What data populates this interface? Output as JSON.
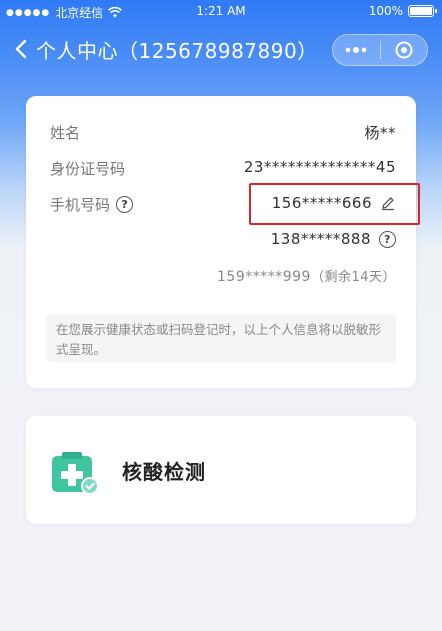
{
  "status_bar": {
    "signal_dots": "●●●●●",
    "carrier": "北京经信",
    "wifi_icon": "wifi-icon",
    "time": "1:21 AM",
    "battery": "100%"
  },
  "nav": {
    "title": "个人中心（125678987890）",
    "back_icon": "chevron-left-icon",
    "more_icon": "more-dots-icon",
    "close_icon": "target-icon"
  },
  "info": {
    "name": {
      "label": "姓名",
      "value": "杨**"
    },
    "id": {
      "label": "身份证号码",
      "value": "23**************45"
    },
    "phone": {
      "label": "手机号码",
      "primary": "156*****666",
      "secondary": "138*****888",
      "tertiary": "159*****999",
      "tertiary_note": "（剩余14天）"
    },
    "notice": "在您展示健康状态或扫码登记时，以上个人信息将以脱敏形式呈现。"
  },
  "test": {
    "label": "核酸检测"
  },
  "colors": {
    "primary_blue": "#2f7af5",
    "link_blue": "#4a8be0",
    "highlight_red": "#d9262b",
    "icon_green": "#3fc6a0"
  }
}
